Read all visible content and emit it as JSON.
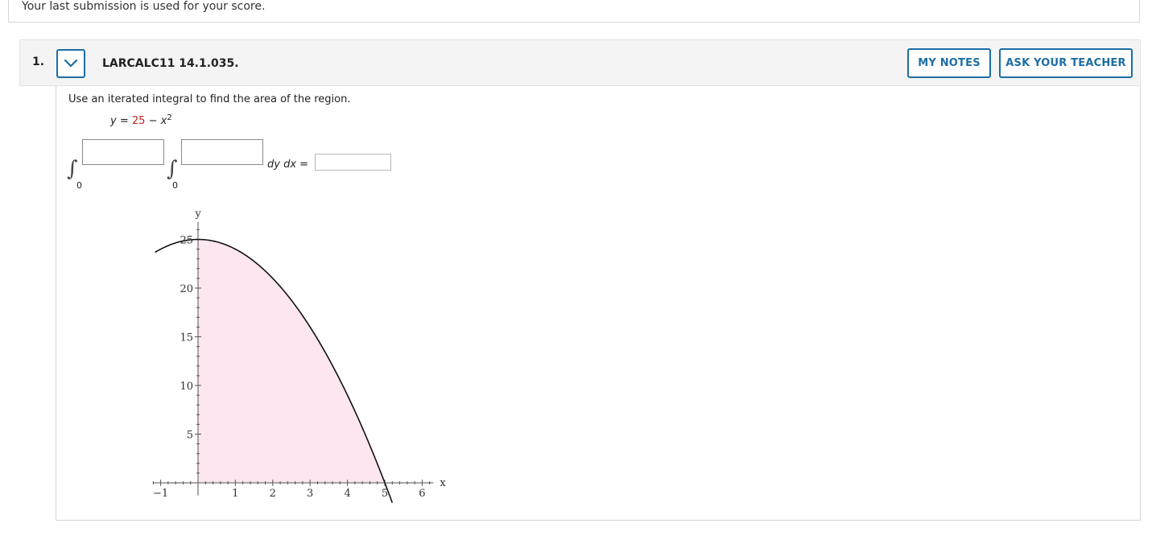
{
  "banner": {
    "text": "Your last submission is used for your score."
  },
  "question": {
    "number": "1.",
    "id": "LARCALC11 14.1.035.",
    "my_notes": "MY NOTES",
    "ask_teacher": "ASK YOUR TEACHER",
    "prompt": "Use an iterated integral to find the area of the region.",
    "equation": {
      "lhs": "y",
      "eq": "=",
      "constant": "25",
      "minus": "−",
      "var": "x",
      "power": "2"
    },
    "integral": {
      "outer_lower": "0",
      "inner_lower": "0",
      "outer_upper_value": "",
      "inner_upper_value": "",
      "differentials": "dy dx",
      "equals": "=",
      "answer_value": ""
    }
  },
  "colors": {
    "accent": "#1c6ea4",
    "region_fill": "#fde6f0",
    "constant_red": "#cc1f1f"
  },
  "chart_data": {
    "type": "area",
    "function": "y = 25 - x^2",
    "shaded_region": {
      "x_from": 0,
      "x_to": 5,
      "y_from": 0
    },
    "xlabel": "x",
    "ylabel": "y",
    "xlim": [
      -1.2,
      6.3
    ],
    "ylim": [
      -1,
      26
    ],
    "x_ticks": [
      -1,
      1,
      2,
      3,
      4,
      5,
      6
    ],
    "x_tick_labels": [
      "−1",
      "1",
      "2",
      "3",
      "4",
      "5",
      "6"
    ],
    "y_ticks": [
      5,
      10,
      15,
      20,
      25
    ],
    "y_tick_labels": [
      "5",
      "10",
      "15",
      "20",
      "25"
    ],
    "grid": false
  }
}
